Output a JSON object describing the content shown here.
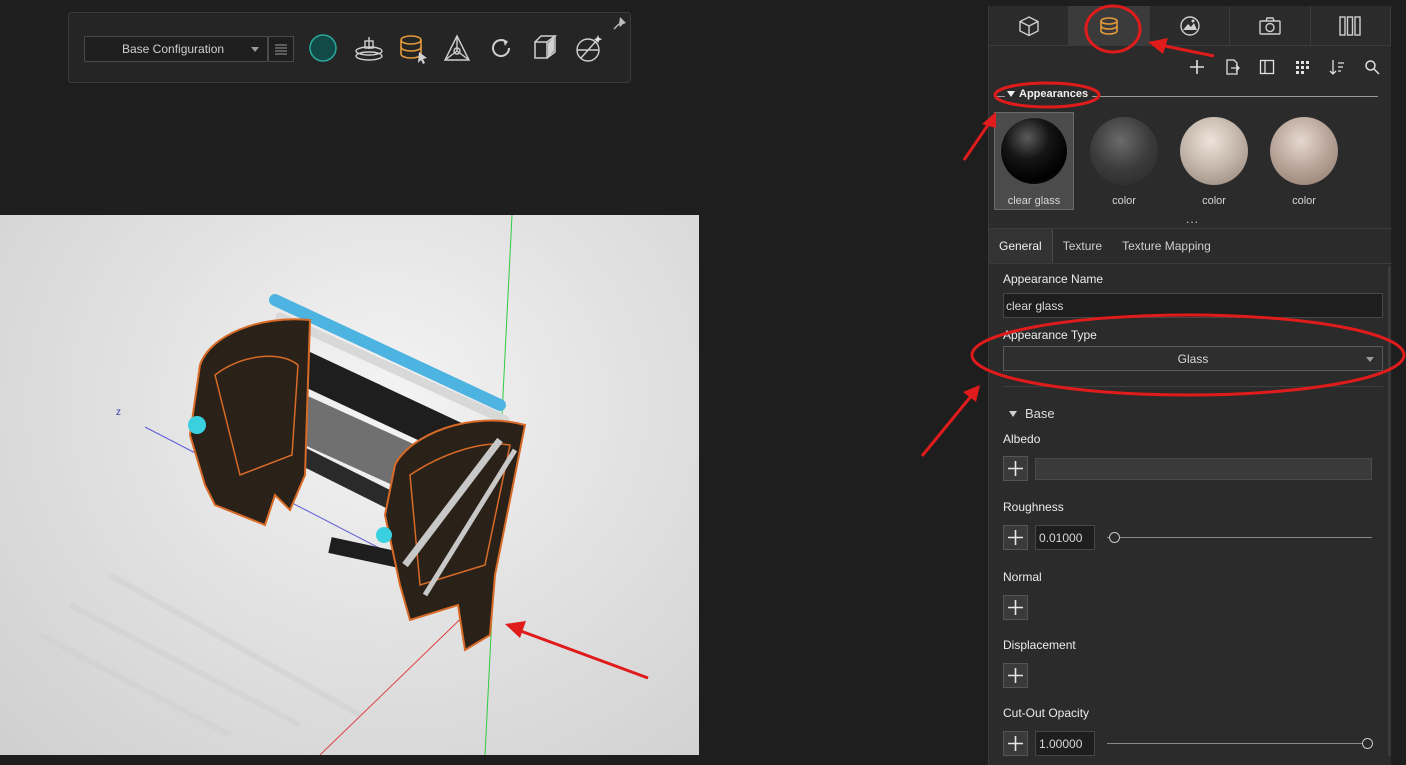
{
  "toolbar": {
    "config_value": "Base Configuration",
    "icons": [
      "list-icon",
      "sphere-icon",
      "turntable-icon",
      "appearance-pick-icon",
      "axis-triad-icon",
      "refresh-icon",
      "box-icon",
      "magic-wand-icon",
      "pin-icon"
    ]
  },
  "viewport": {
    "axis_label": "z"
  },
  "panel": {
    "tabs": [
      "cube-icon",
      "appearance-icon",
      "environment-icon",
      "camera-icon",
      "library-icon"
    ],
    "active_tab": 1,
    "actions": [
      "plus-icon",
      "export-icon",
      "panel-icon",
      "grid-icon",
      "sort-icon",
      "search-icon"
    ],
    "section_title": "Appearances",
    "swatches": [
      {
        "label": "clear glass",
        "color": "#111111",
        "selected": true
      },
      {
        "label": "color",
        "color": "#3c3c3c",
        "selected": false
      },
      {
        "label": "color",
        "color": "#c2b4a8",
        "selected": false
      },
      {
        "label": "color",
        "color": "#b8a398",
        "selected": false
      }
    ],
    "more": "...",
    "subtabs": [
      "General",
      "Texture",
      "Texture Mapping"
    ],
    "appearance_name_label": "Appearance Name",
    "appearance_name_value": "clear glass",
    "appearance_type_label": "Appearance Type",
    "appearance_type_value": "Glass",
    "base_header": "Base",
    "albedo_label": "Albedo",
    "roughness_label": "Roughness",
    "roughness_value": "0.01000",
    "roughness_level": 0.01,
    "normal_label": "Normal",
    "displacement_label": "Displacement",
    "cutout_label": "Cut-Out Opacity",
    "cutout_value": "1.00000",
    "cutout_level": 1.0
  },
  "annotations": {
    "color": "#e01b1b"
  }
}
